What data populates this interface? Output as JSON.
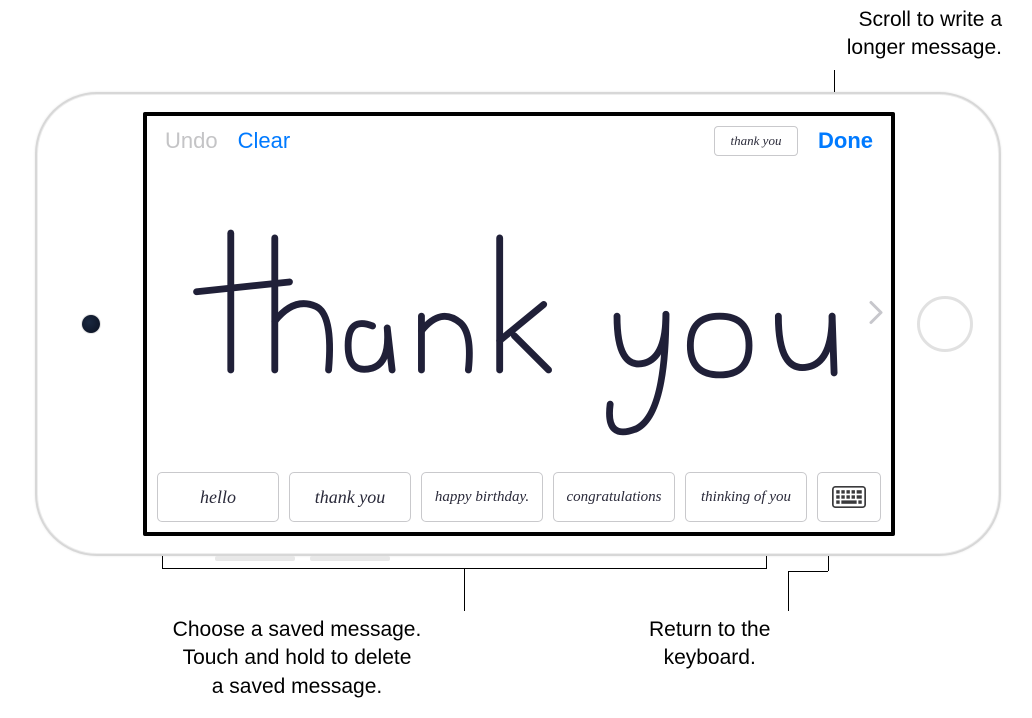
{
  "callouts": {
    "top_right": "Scroll to write a\nlonger message.",
    "bottom_left": "Choose a saved message.\nTouch and hold to delete\na saved message.",
    "bottom_right": "Return to the\nkeyboard."
  },
  "toolbar": {
    "undo": "Undo",
    "clear": "Clear",
    "preview_text": "thank you",
    "done": "Done"
  },
  "canvas": {
    "handwritten_text": "thank you"
  },
  "saved_messages": [
    "hello",
    "thank you",
    "happy birthday.",
    "congratulations",
    "thinking of you"
  ],
  "colors": {
    "ios_blue": "#007aff",
    "disabled_gray": "#c4c4c6",
    "ink": "#202038"
  }
}
